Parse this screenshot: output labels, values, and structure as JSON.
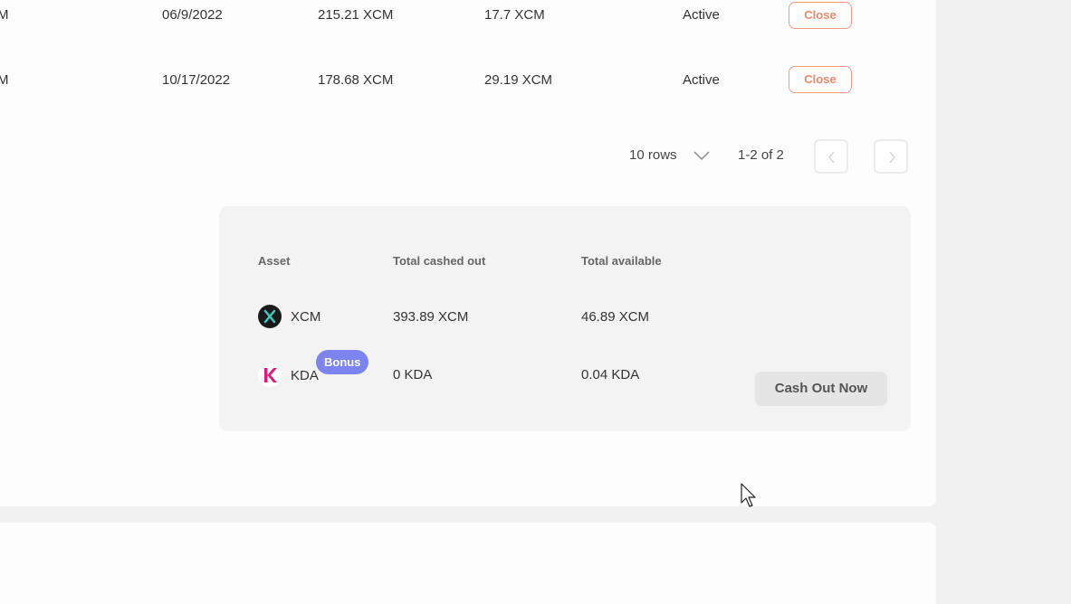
{
  "positions_table": {
    "rows": [
      {
        "amount_fragment": "M",
        "date": "06/9/2022",
        "amount": "215.21 XCM",
        "reward": "17.7 XCM",
        "status": "Active",
        "action_label": "Close"
      },
      {
        "amount_fragment": "M",
        "date": "10/17/2022",
        "amount": "178.68 XCM",
        "reward": "29.19 XCM",
        "status": "Active",
        "action_label": "Close"
      }
    ],
    "pagination": {
      "rows_per_page": "10 rows",
      "range": "1-2 of 2"
    }
  },
  "summary": {
    "headers": {
      "asset": "Asset",
      "total_cashed_out": "Total cashed out",
      "total_available": "Total available"
    },
    "assets": [
      {
        "symbol": "XCM",
        "icon": "xcm-logo",
        "total_cashed_out": "393.89 XCM",
        "total_available": "46.89 XCM"
      },
      {
        "symbol": "KDA",
        "icon": "kda-logo",
        "total_cashed_out": "0 KDA",
        "total_available": "0.04 KDA",
        "badge": "Bonus"
      }
    ],
    "cash_out_label": "Cash Out Now"
  },
  "colors": {
    "close_border": "#ef9b82",
    "close_text": "#e8896c",
    "bonus_badge": "#7d84f0",
    "xcm_icon": "#1a1a1a",
    "xcm_accent": "#3fc9c1",
    "kda_accent": "#e0197d"
  }
}
